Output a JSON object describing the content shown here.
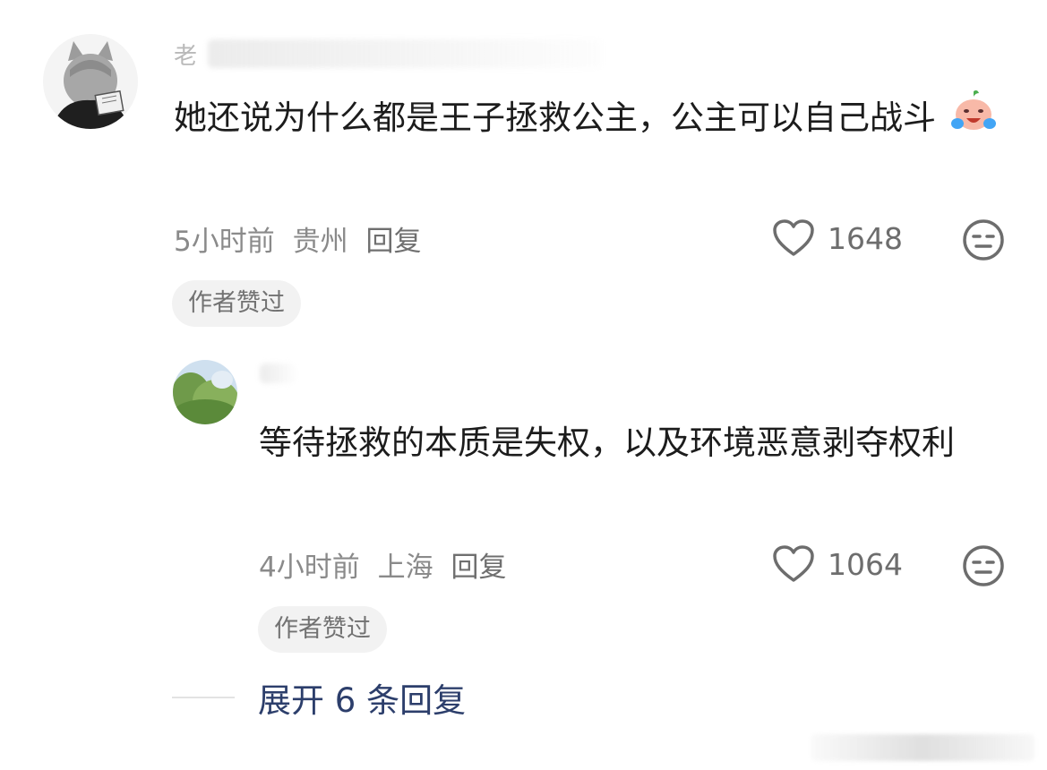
{
  "comment": {
    "username": "老",
    "text": "她还说为什么都是王子拯救公主，公主可以自己战斗",
    "emoji": "crying-laughing-emoji",
    "time": "5小时前",
    "location": "贵州",
    "reply_label": "回复",
    "like_count": "1648",
    "author_liked": "作者赞过"
  },
  "reply": {
    "username": "",
    "text": "等待拯救的本质是失权，以及环境恶意剥夺权利",
    "time": "4小时前",
    "location": "上海",
    "reply_label": "回复",
    "like_count": "1064",
    "author_liked": "作者赞过"
  },
  "expand": {
    "label": "展开 6 条回复"
  },
  "colors": {
    "text": "#1c1c1c",
    "meta": "#8a8a8a",
    "link": "#2c3e6b",
    "chip_bg": "#f2f2f2"
  }
}
